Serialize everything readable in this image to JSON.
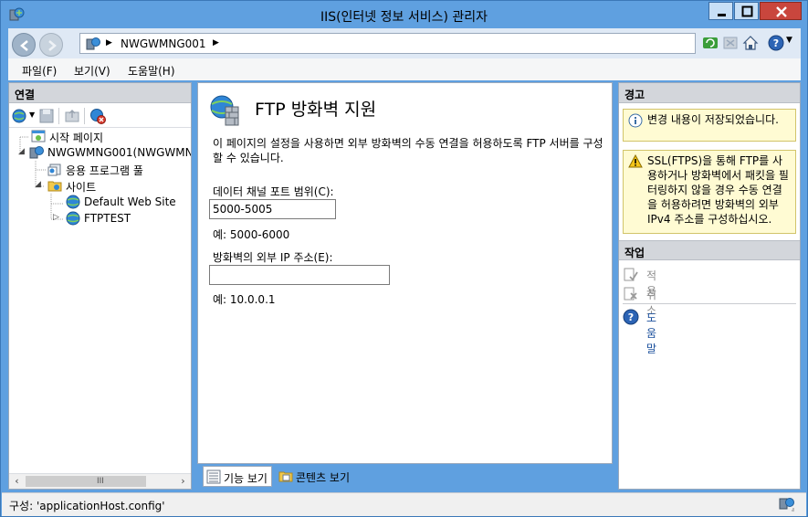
{
  "window": {
    "title": "IIS(인터넷 정보 서비스) 관리자"
  },
  "address": {
    "path": "NWGWMNG001"
  },
  "menu": {
    "items": [
      "파일(F)",
      "보기(V)",
      "도움말(H)"
    ]
  },
  "connections": {
    "header": "연결",
    "tree": [
      {
        "label": "시작 페이지"
      },
      {
        "label": "NWGWMNG001(NWGWMNG"
      },
      {
        "label": "응용 프로그램 풀"
      },
      {
        "label": "사이트"
      },
      {
        "label": "Default Web Site"
      },
      {
        "label": "FTPTEST"
      }
    ],
    "scroll_grip": "III"
  },
  "feature": {
    "title": "FTP 방화벽 지원",
    "description": "이 페이지의 설정을 사용하면 외부 방화벽의 수동 연결을 허용하도록 FTP 서버를 구성할 수 있습니다.",
    "port_range_label": "데이터 채널 포트 범위(C):",
    "port_range_value": "5000-5005",
    "port_range_example": "예: 5000-6000",
    "external_ip_label": "방화벽의 외부 IP 주소(E):",
    "external_ip_value": "",
    "external_ip_example": "예: 10.0.0.1"
  },
  "view_tabs": {
    "features": "기능 보기",
    "content": "콘텐츠 보기"
  },
  "alerts": {
    "header": "경고",
    "info": "변경 내용이 저장되었습니다.",
    "warning": "SSL(FTPS)을 통해 FTP를 사용하거나 방화벽에서 패킷을 필터링하지 않을 경우 수동 연결을 허용하려면 방화벽의 외부 IPv4 주소를 구성하십시오."
  },
  "actions": {
    "header": "작업",
    "apply": "적용",
    "cancel": "취소",
    "help": "도움말"
  },
  "status": {
    "text": "구성: 'applicationHost.config'"
  },
  "colors": {
    "window_frame": "#5fa0e0",
    "close_button": "#c9463d",
    "alert_bg": "#fffbd3",
    "link": "#1a4f9c"
  }
}
